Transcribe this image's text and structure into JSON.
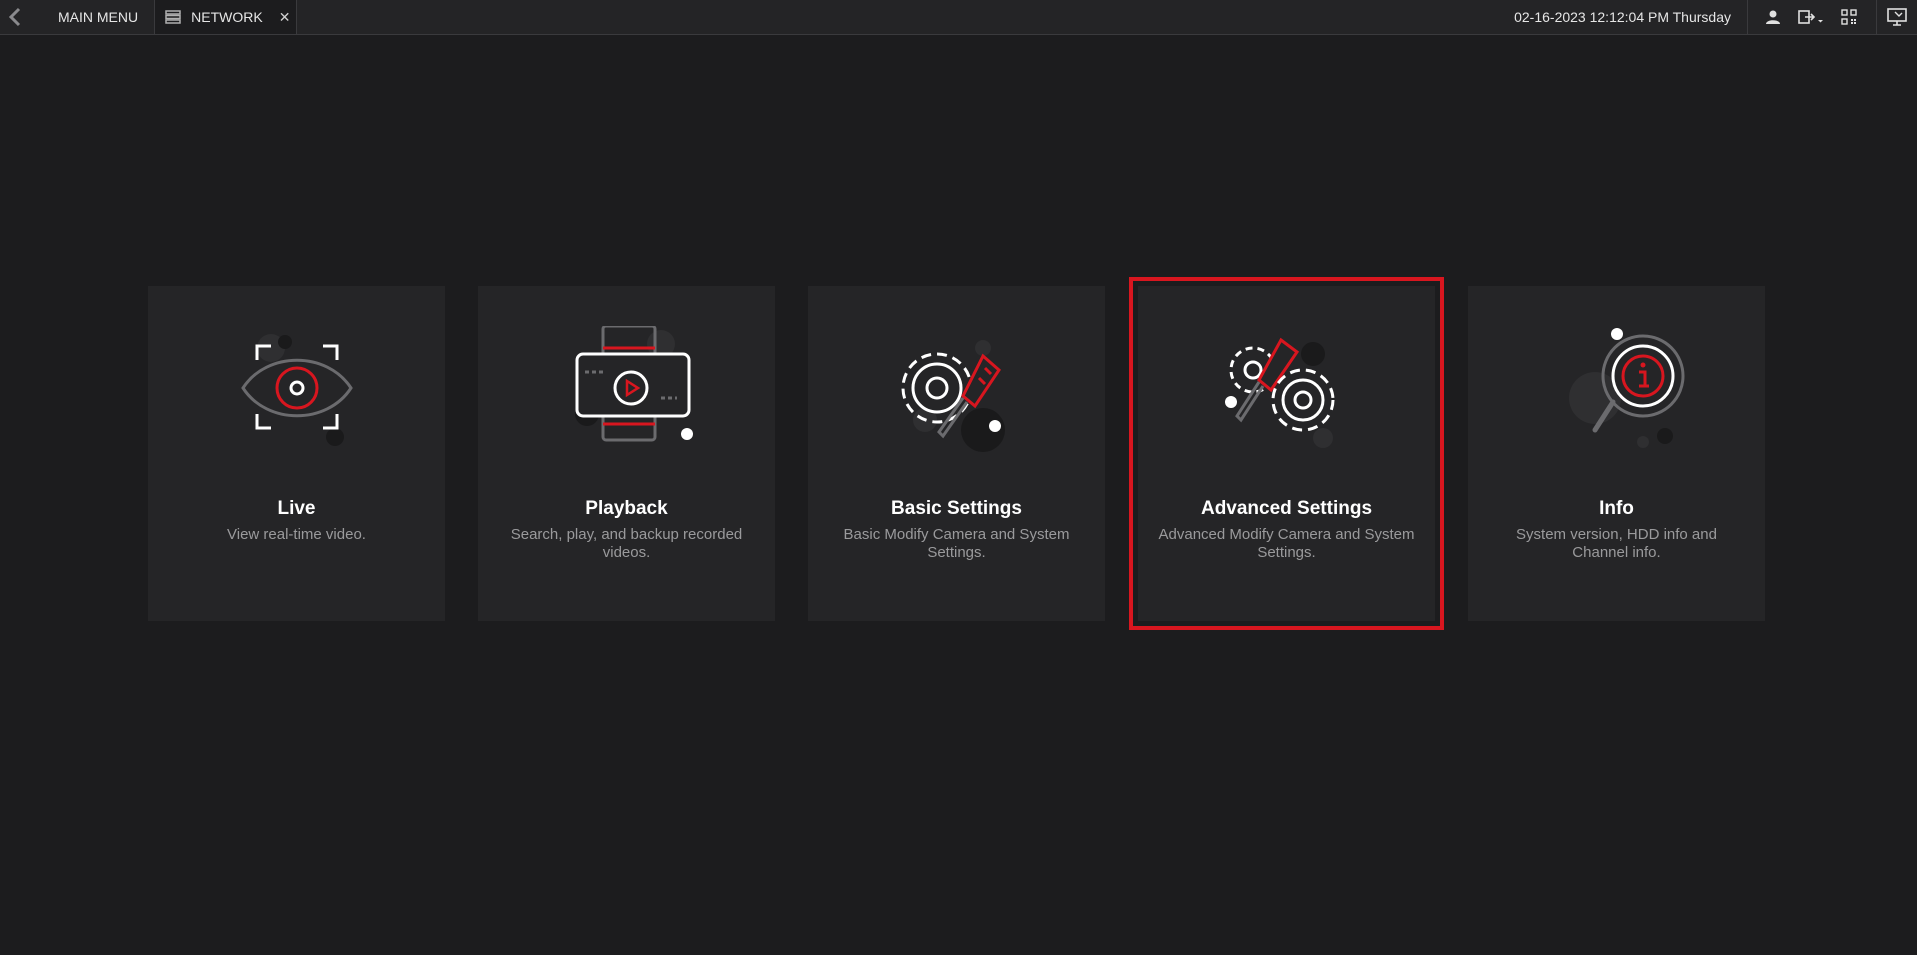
{
  "header": {
    "main_menu_label": "MAIN MENU",
    "active_tab_label": "NETWORK",
    "close_symbol": "✕",
    "datetime": "02-16-2023 12:12:04 PM Thursday"
  },
  "cards": [
    {
      "title": "Live",
      "desc": "View real-time video."
    },
    {
      "title": "Playback",
      "desc": "Search, play, and backup recorded videos."
    },
    {
      "title": "Basic Settings",
      "desc": "Basic Modify Camera and System Settings."
    },
    {
      "title": "Advanced Settings",
      "desc": "Advanced Modify Camera and System Settings."
    },
    {
      "title": "Info",
      "desc": "System version, HDD info and Channel info."
    }
  ],
  "selected_card": "Advanced Settings",
  "colors": {
    "accent": "#d8161f",
    "icon_white": "#ffffff",
    "icon_gray": "#6b6b6e",
    "background": "#1c1c1e",
    "card": "#252527"
  }
}
